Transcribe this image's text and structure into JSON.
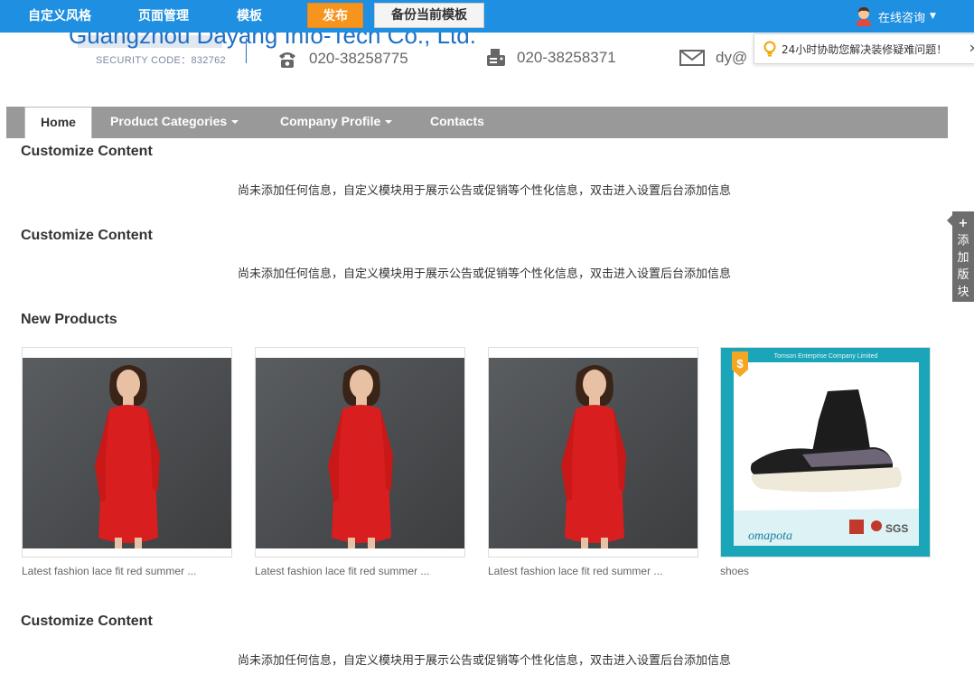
{
  "topbar": {
    "menu": [
      "自定义风格",
      "页面管理",
      "模板"
    ],
    "publish_label": "发布",
    "backup_label": "备份当前模板",
    "consult_label": "在线咨询"
  },
  "header": {
    "company_name": "Guangzhou Dayang Info-Tech Co., Ltd.",
    "security_code": "SECURITY CODE：832762",
    "phone": "020-38258775",
    "fax": "020-38258371",
    "email": "dy@"
  },
  "tooltip": {
    "text": "24小时协助您解决装修疑难问题！",
    "close": "✕"
  },
  "nav": {
    "home": "Home",
    "product_categories": "Product Categories",
    "company_profile": "Company Profile",
    "contacts": "Contacts"
  },
  "sections": {
    "custom1_title": "Customize Content",
    "custom1_msg": "尚未添加任何信息，自定义模块用于展示公告或促销等个性化信息，双击进入设置后台添加信息",
    "custom2_title": "Customize Content",
    "custom2_msg": "尚未添加任何信息，自定义模块用于展示公告或促销等个性化信息，双击进入设置后台添加信息",
    "new_products_title": "New Products",
    "custom3_title": "Customize Content",
    "custom3_msg": "尚未添加任何信息，自定义模块用于展示公告或促销等个性化信息，双击进入设置后台添加信息"
  },
  "products": [
    {
      "caption": "Latest fashion lace fit red summer ..."
    },
    {
      "caption": "Latest fashion lace fit red summer ..."
    },
    {
      "caption": "Latest fashion lace fit red summer ..."
    },
    {
      "caption": "shoes"
    }
  ],
  "shoe_card": {
    "banner": "Tomson Enterprise Company Limited",
    "brand": "omapota",
    "cert": "SGS",
    "badge": "$"
  },
  "side_add": [
    "+",
    "添",
    "加",
    "版",
    "块"
  ],
  "colors": {
    "topbar": "#1e8fe1",
    "publish": "#f7941d",
    "nav": "#999999"
  }
}
